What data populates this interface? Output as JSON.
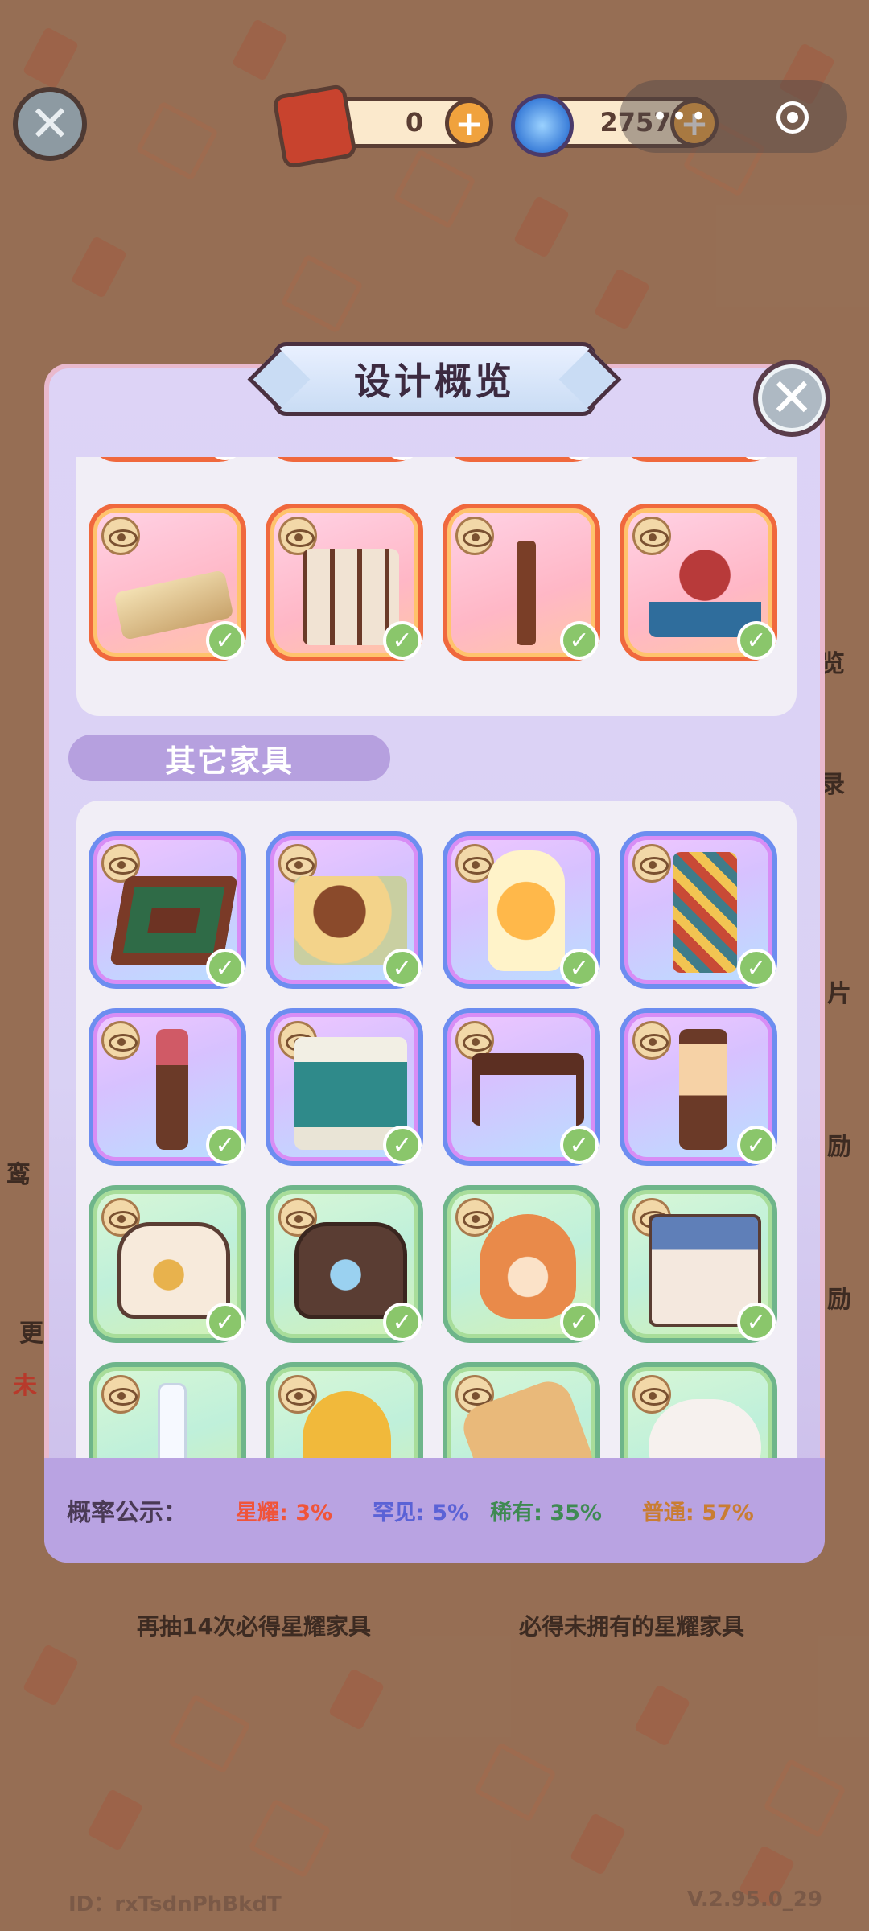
{
  "top_bar": {
    "ticket_count": "0",
    "gem_count": "2757",
    "capsule_dots": "•••"
  },
  "modal": {
    "title": "设计概览",
    "section_other": "其它家具"
  },
  "tiles": {
    "row0": [
      "partial-item-1",
      "partial-item-2",
      "partial-item-3",
      "partial-item-4"
    ],
    "row1": [
      "ivory-fence",
      "folding-screen",
      "incense-stand",
      "plum-bonsai"
    ],
    "other": [
      "mahjong-table",
      "food-platter",
      "fruit-drink-jar",
      "tapestry-panel",
      "flower-stand",
      "ornate-gate",
      "long-bench",
      "floor-lantern",
      "cat-bag-white",
      "cat-bag-brown",
      "fox-plush",
      "dollhouse",
      "glass-pane",
      "pineapple-seat",
      "cushion",
      "white-plush"
    ]
  },
  "probability": {
    "label": "概率公示：",
    "star": "星耀: 3%",
    "rare": "罕见: 5%",
    "uncommon": "稀有: 35%",
    "common": "普通: 57%"
  },
  "bottom": {
    "left_note": "再抽14次必得星耀家具",
    "right_note": "必得未拥有的星耀家具",
    "id_text": "ID：rxTsdnPhBkdT",
    "version": "V.2.95.0_29"
  },
  "side_peek": {
    "r1": "览",
    "r2": "录",
    "r3": "片",
    "r4": "励",
    "r5": "励",
    "l1": "鸾",
    "l2": "更",
    "l3": "未"
  },
  "colors": {
    "star": "#f0543a",
    "rare": "#5b62d6",
    "uncommon": "#3f8a53",
    "common": "#c97d33"
  }
}
